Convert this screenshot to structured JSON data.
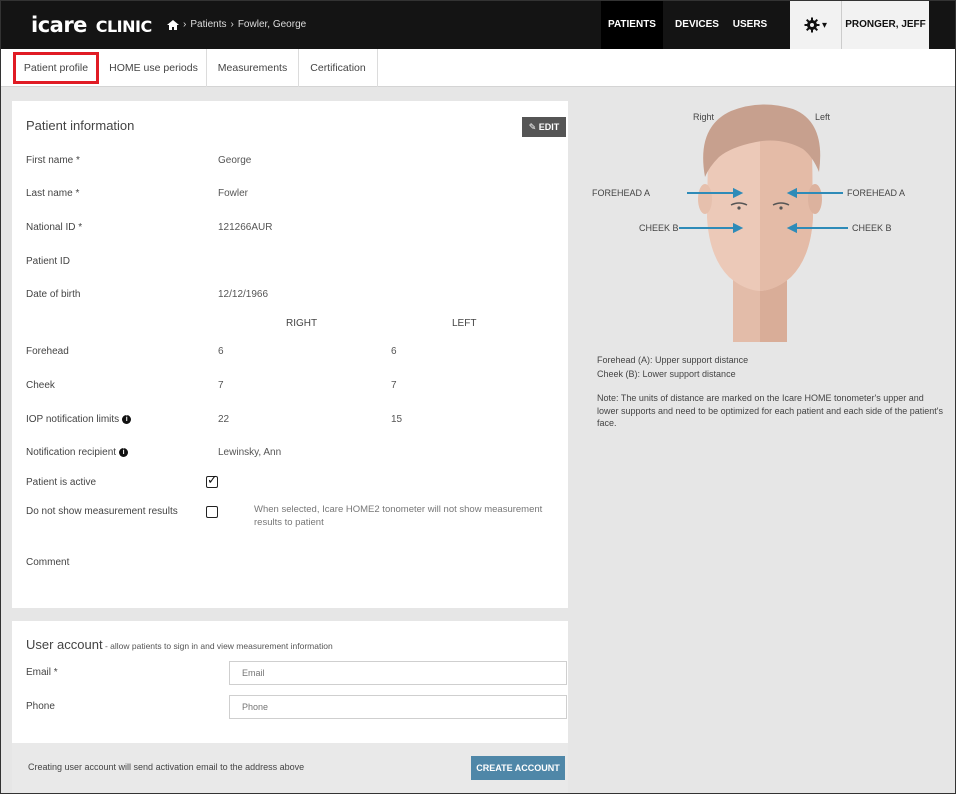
{
  "app": {
    "logo_main": "icare",
    "logo_sub": "CLINIC",
    "breadcrumb": [
      "Patients",
      "Fowler, George"
    ]
  },
  "nav": {
    "patients": "PATIENTS",
    "devices": "DEVICES",
    "users": "USERS",
    "user_menu": "PRONGER, JEFF ▾",
    "settings_caret": "▾"
  },
  "tabs": [
    "Patient profile",
    "HOME use periods",
    "Measurements",
    "Certification"
  ],
  "patient": {
    "title": "Patient information",
    "edit_label": "EDIT",
    "fields": {
      "first_name_label": "First name *",
      "first_name": "George",
      "last_name_label": "Last name *",
      "last_name": "Fowler",
      "national_id_label": "National ID *",
      "national_id": "121266AUR",
      "patient_id_label": "Patient ID",
      "patient_id": "",
      "dob_label": "Date of birth",
      "dob": "12/12/1966"
    },
    "col_right": "RIGHT",
    "col_left": "LEFT",
    "forehead_label": "Forehead",
    "forehead_right": "6",
    "forehead_left": "6",
    "cheek_label": "Cheek",
    "cheek_right": "7",
    "cheek_left": "7",
    "iop_label": "IOP notification limits",
    "iop_right": "22",
    "iop_left": "15",
    "recipient_label": "Notification recipient",
    "recipient": "Lewinsky, Ann",
    "active_label": "Patient is active",
    "active_checked": true,
    "hide_results_label": "Do not show measurement results",
    "hide_results_checked": false,
    "hide_results_hint": "When selected, Icare HOME2 tonometer will not show measurement results to patient",
    "comment_label": "Comment"
  },
  "account": {
    "title": "User account",
    "subtitle": " - allow patients to sign in and view measurement information",
    "email_label": "Email *",
    "email_placeholder": "Email",
    "phone_label": "Phone",
    "phone_placeholder": "Phone",
    "footer_text": "Creating user account will send activation email to the address above",
    "create_label": "CREATE ACCOUNT"
  },
  "face": {
    "right_label": "Right",
    "left_label": "Left",
    "forehead_a": "FOREHEAD A",
    "cheek_b": "CHEEK B",
    "legend_forehead": "Forehead (A):  Upper support distance",
    "legend_cheek": "Cheek (B):       Lower support distance",
    "note": "Note: The units of distance are marked on the Icare HOME tonometer's upper and lower supports and need to be optimized for each patient and each side of the patient's face.",
    "arrow_color": "#2e8bb8",
    "skin_color": "#e9c6b5",
    "hair_color": "#c89d8a"
  }
}
